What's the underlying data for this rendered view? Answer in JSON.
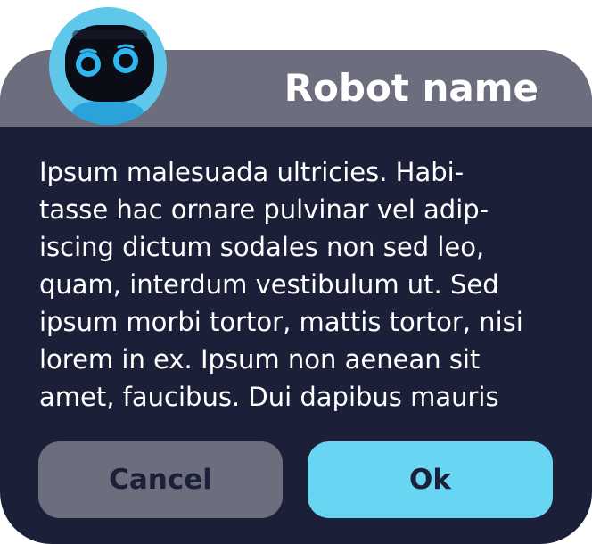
{
  "dialog": {
    "title": "Robot name",
    "message": "Ipsum malesuada ultricies. Habi-\ntasse hac ornare pulvinar vel adip-\niscing dictum sodales non sed leo,\nquam, interdum vestibulum ut. Sed\nipsum morbi tortor, mattis tortor, nisi\nlorem in ex. Ipsum non aenean sit\namet, faucibus. Dui dapibus mauris",
    "cancel_label": "Cancel",
    "ok_label": "Ok"
  },
  "avatar": {
    "icon": "robot-face-icon"
  },
  "colors": {
    "header": "#6c6e7e",
    "body": "#1b2038",
    "accent": "#68d6f3",
    "cancel_button": "#6c6e7e",
    "text": "#ffffff"
  }
}
